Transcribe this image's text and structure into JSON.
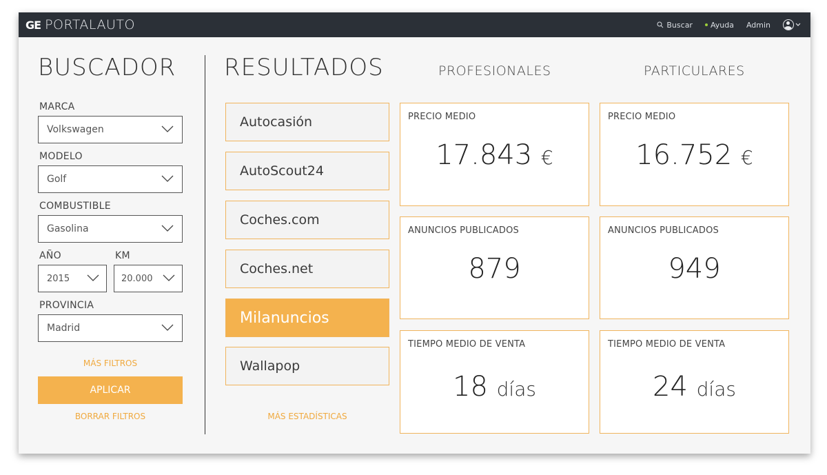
{
  "app": {
    "logo_mark": "GE",
    "title": "PORTALAUTO",
    "top_actions": {
      "search": "Buscar",
      "help": "Ayuda",
      "admin": "Admin"
    }
  },
  "sidebar": {
    "title": "BUSCADOR",
    "fields": {
      "marca": {
        "label": "MARCA",
        "value": "Volkswagen"
      },
      "modelo": {
        "label": "MODELO",
        "value": "Golf"
      },
      "combustible": {
        "label": "COMBUSTIBLE",
        "value": "Gasolina"
      },
      "anio": {
        "label": "AÑO",
        "value": "2015"
      },
      "km": {
        "label": "KM",
        "value": "20.000"
      },
      "provincia": {
        "label": "PROVINCIA",
        "value": "Madrid"
      }
    },
    "more_filters": "MÁS FILTROS",
    "apply": "APLICAR",
    "clear_filters": "BORRAR FILTROS"
  },
  "results": {
    "title": "RESULTADOS",
    "sources": [
      "Autocasión",
      "AutoScout24",
      "Coches.com",
      "Coches.net",
      "Milanuncios",
      "Wallapop"
    ],
    "active_source": "Milanuncios",
    "more_stats": "MÁS ESTADÍSTICAS",
    "columns": {
      "profesionales": {
        "title": "PROFESIONALES",
        "precio_medio": {
          "label": "PRECIO MEDIO",
          "value": "17.843",
          "unit": "€"
        },
        "anuncios": {
          "label": "ANUNCIOS PUBLICADOS",
          "value": "879"
        },
        "tiempo": {
          "label": "TIEMPO MEDIO DE VENTA",
          "value": "18",
          "unit": "días"
        }
      },
      "particulares": {
        "title": "PARTICULARES",
        "precio_medio": {
          "label": "PRECIO MEDIO",
          "value": "16.752",
          "unit": "€"
        },
        "anuncios": {
          "label": "ANUNCIOS PUBLICADOS",
          "value": "949"
        },
        "tiempo": {
          "label": "TIEMPO MEDIO DE VENTA",
          "value": "24",
          "unit": "días"
        }
      }
    }
  },
  "colors": {
    "accent": "#f4b24e",
    "topbar": "#2b3037",
    "status_dot": "#9ccf3a"
  }
}
